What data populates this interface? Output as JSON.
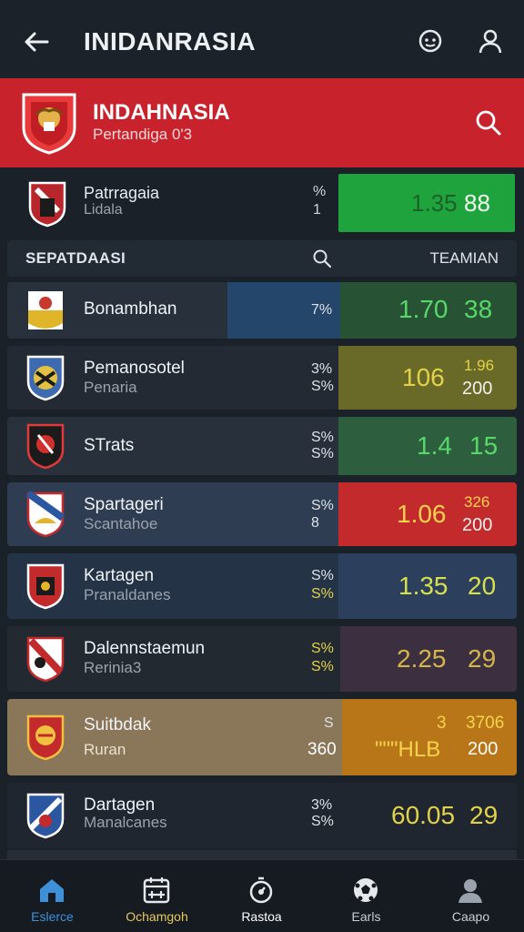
{
  "header": {
    "title": "INIDANRASIA"
  },
  "banner": {
    "title": "INDAHNASIA",
    "subtitle": "Pertandiga 0'3"
  },
  "featured": {
    "name": "Patrragaia",
    "sub": "Lidala",
    "pct1": "%",
    "pct2": "1",
    "odd1": "1.35",
    "odd2": "88"
  },
  "section": {
    "left": "SEPATDAASI",
    "right": "TEAMIAN"
  },
  "rows": [
    {
      "name": "Bonambhan",
      "sub": "",
      "pct1": "7%",
      "pct2": "",
      "odd_main": "1.70",
      "odd_side1": "38",
      "odd_side2": ""
    },
    {
      "name": "Pemanosotel",
      "sub": "Penaria",
      "pct1": "3%",
      "pct2": "S%",
      "odd_main": "106",
      "odd_side1": "1.96",
      "odd_side2": "200"
    },
    {
      "name": "STrats",
      "sub": "",
      "pct1": "S%",
      "pct2": "S%",
      "odd_main": "1.4",
      "odd_side1": "15",
      "odd_side2": ""
    },
    {
      "name": "Spartageri",
      "sub": "Scantahoe",
      "pct1": "S%",
      "pct2": "8",
      "odd_main": "1.06",
      "odd_side1": "326",
      "odd_side2": "200"
    },
    {
      "name": "Kartagen",
      "sub": "Pranaldanes",
      "pct1": "S%",
      "pct2": "S%",
      "odd_main": "1.35",
      "odd_side1": "20",
      "odd_side2": ""
    },
    {
      "name": "Dalennstaemun",
      "sub": "Rerinia3",
      "pct1": "S%",
      "pct2": "S%",
      "odd_main": "2.25",
      "odd_side1": "29",
      "odd_side2": ""
    },
    {
      "name": "Suitbdak",
      "sub": "Ruran",
      "pct1": "S",
      "pct2": "360",
      "odd_main": "\"\"\"HLB",
      "odd_side1": "3",
      "odd_side2": "3706",
      "odd_side3": "200"
    },
    {
      "name": "Dartagen",
      "sub": "Manalcanes",
      "pct1": "3%",
      "pct2": "S%",
      "odd_main": "60.05",
      "odd_side1": "29",
      "odd_side2": ""
    }
  ],
  "nav": [
    {
      "label": "Eslerce"
    },
    {
      "label": "Ochamgoh"
    },
    {
      "label": "Rastoa"
    },
    {
      "label": "Earls"
    },
    {
      "label": "Caapo"
    }
  ],
  "colors": {
    "banner_red": "#c8222c",
    "odds_green": "#1fa33c",
    "odds_dark_green": "#2d5f3f",
    "odds_olive": "#6a6a28",
    "odds_red": "#c22a2c",
    "odds_navy": "#2c3f5c",
    "odds_purple": "#3c3040",
    "odds_orange": "#b97618",
    "text_yellow": "#e2d24a",
    "text_green": "#57d86a",
    "nav_active": "#3e90d8"
  }
}
